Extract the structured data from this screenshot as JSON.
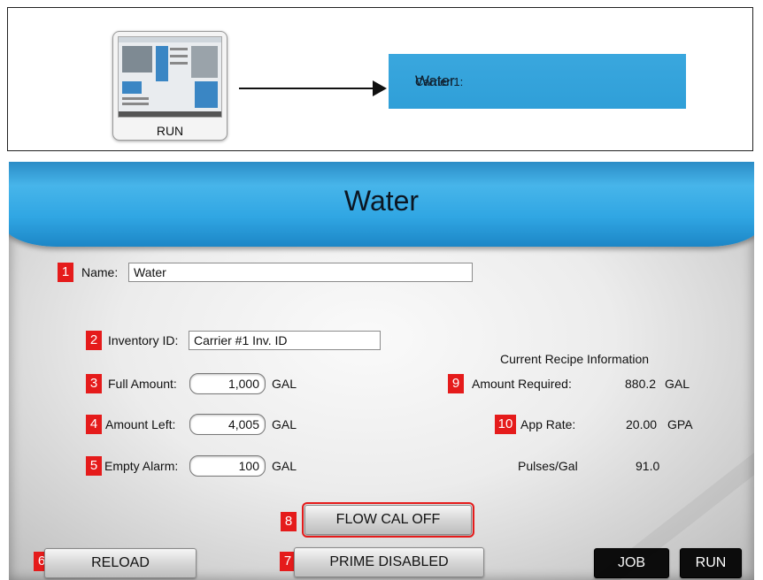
{
  "nav": {
    "thumbnail_label": "RUN",
    "carrier_label": "Carrier 1:",
    "carrier_value": "Water"
  },
  "screen": {
    "title": "Water",
    "fields": {
      "name": {
        "marker": "1",
        "label": "Name:",
        "value": "Water"
      },
      "inventory_id": {
        "marker": "2",
        "label": "Inventory ID:",
        "value": "Carrier #1 Inv. ID"
      },
      "full_amount": {
        "marker": "3",
        "label": "Full Amount:",
        "value": "1,000",
        "unit": "GAL"
      },
      "amount_left": {
        "marker": "4",
        "label": "Amount Left:",
        "value": "4,005",
        "unit": "GAL"
      },
      "empty_alarm": {
        "marker": "5",
        "label": "Empty Alarm:",
        "value": "100",
        "unit": "GAL"
      }
    },
    "recipe": {
      "heading": "Current Recipe Information",
      "amount_required": {
        "marker": "9",
        "label": "Amount Required:",
        "value": "880.2",
        "unit": "GAL"
      },
      "app_rate": {
        "marker": "10",
        "label": "App Rate:",
        "value": "20.00",
        "unit": "GPA"
      },
      "pulses": {
        "label": "Pulses/Gal",
        "value": "91.0"
      }
    },
    "buttons": {
      "reload": {
        "marker": "6",
        "label": "RELOAD"
      },
      "prime": {
        "marker": "7",
        "label": "PRIME DISABLED"
      },
      "flow_cal": {
        "marker": "8",
        "label": "FLOW CAL OFF"
      },
      "job": {
        "label": "JOB"
      },
      "run": {
        "label": "RUN"
      }
    }
  },
  "colors": {
    "marker_red": "#e51b1b",
    "header_blue": "#30a6e3",
    "banner_blue": "#3aa7de"
  }
}
